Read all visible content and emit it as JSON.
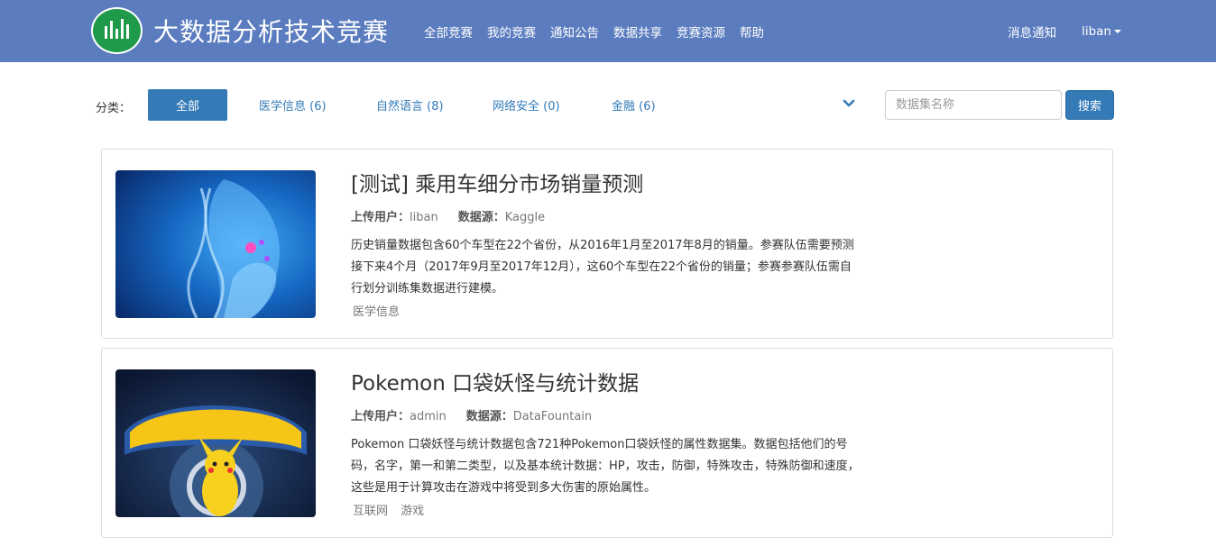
{
  "brand": {
    "title": "大数据分析技术竞赛",
    "logo_icon": "competition-logo-icon"
  },
  "nav": {
    "items": [
      "全部竞赛",
      "我的竞赛",
      "通知公告",
      "数据共享",
      "竞赛资源",
      "帮助"
    ],
    "notifications": "消息通知",
    "user": "liban"
  },
  "filters": {
    "label": "分类：",
    "categories": [
      {
        "label": "全部",
        "active": true
      },
      {
        "label": "医学信息 (6)",
        "active": false
      },
      {
        "label": "自然语言 (8)",
        "active": false
      },
      {
        "label": "网络安全 (0)",
        "active": false
      },
      {
        "label": "金融 (6)",
        "active": false
      }
    ],
    "expand_icon": "chevron-down-icon",
    "search_placeholder": "数据集名称",
    "search_button": "搜索"
  },
  "datasets": [
    {
      "title": "[测试] 乘用车细分市场销量预测",
      "uploader_label": "上传用户：",
      "uploader": "liban",
      "source_label": "数据源：",
      "source": "Kaggle",
      "description": "历史销量数据包含60个车型在22个省份，从2016年1月至2017年8月的销量。参赛队伍需要预测接下来4个月（2017年9月至2017年12月），这60个车型在22个省份的销量；参赛参赛队伍需自行划分训练集数据进行建模。",
      "tags": [
        "医学信息"
      ]
    },
    {
      "title": "Pokemon 口袋妖怪与统计数据",
      "uploader_label": "上传用户：",
      "uploader": "admin",
      "source_label": "数据源：",
      "source": "DataFountain",
      "description": "Pokemon 口袋妖怪与统计数据包含721种Pokemon口袋妖怪的属性数据集。数据包括他们的号码，名字，第一和第二类型，以及基本统计数据：HP，攻击，防御，特殊攻击，特殊防御和速度，这些是用于计算攻击在游戏中将受到多大伤害的原始属性。",
      "tags": [
        "互联网",
        "游戏"
      ]
    }
  ]
}
